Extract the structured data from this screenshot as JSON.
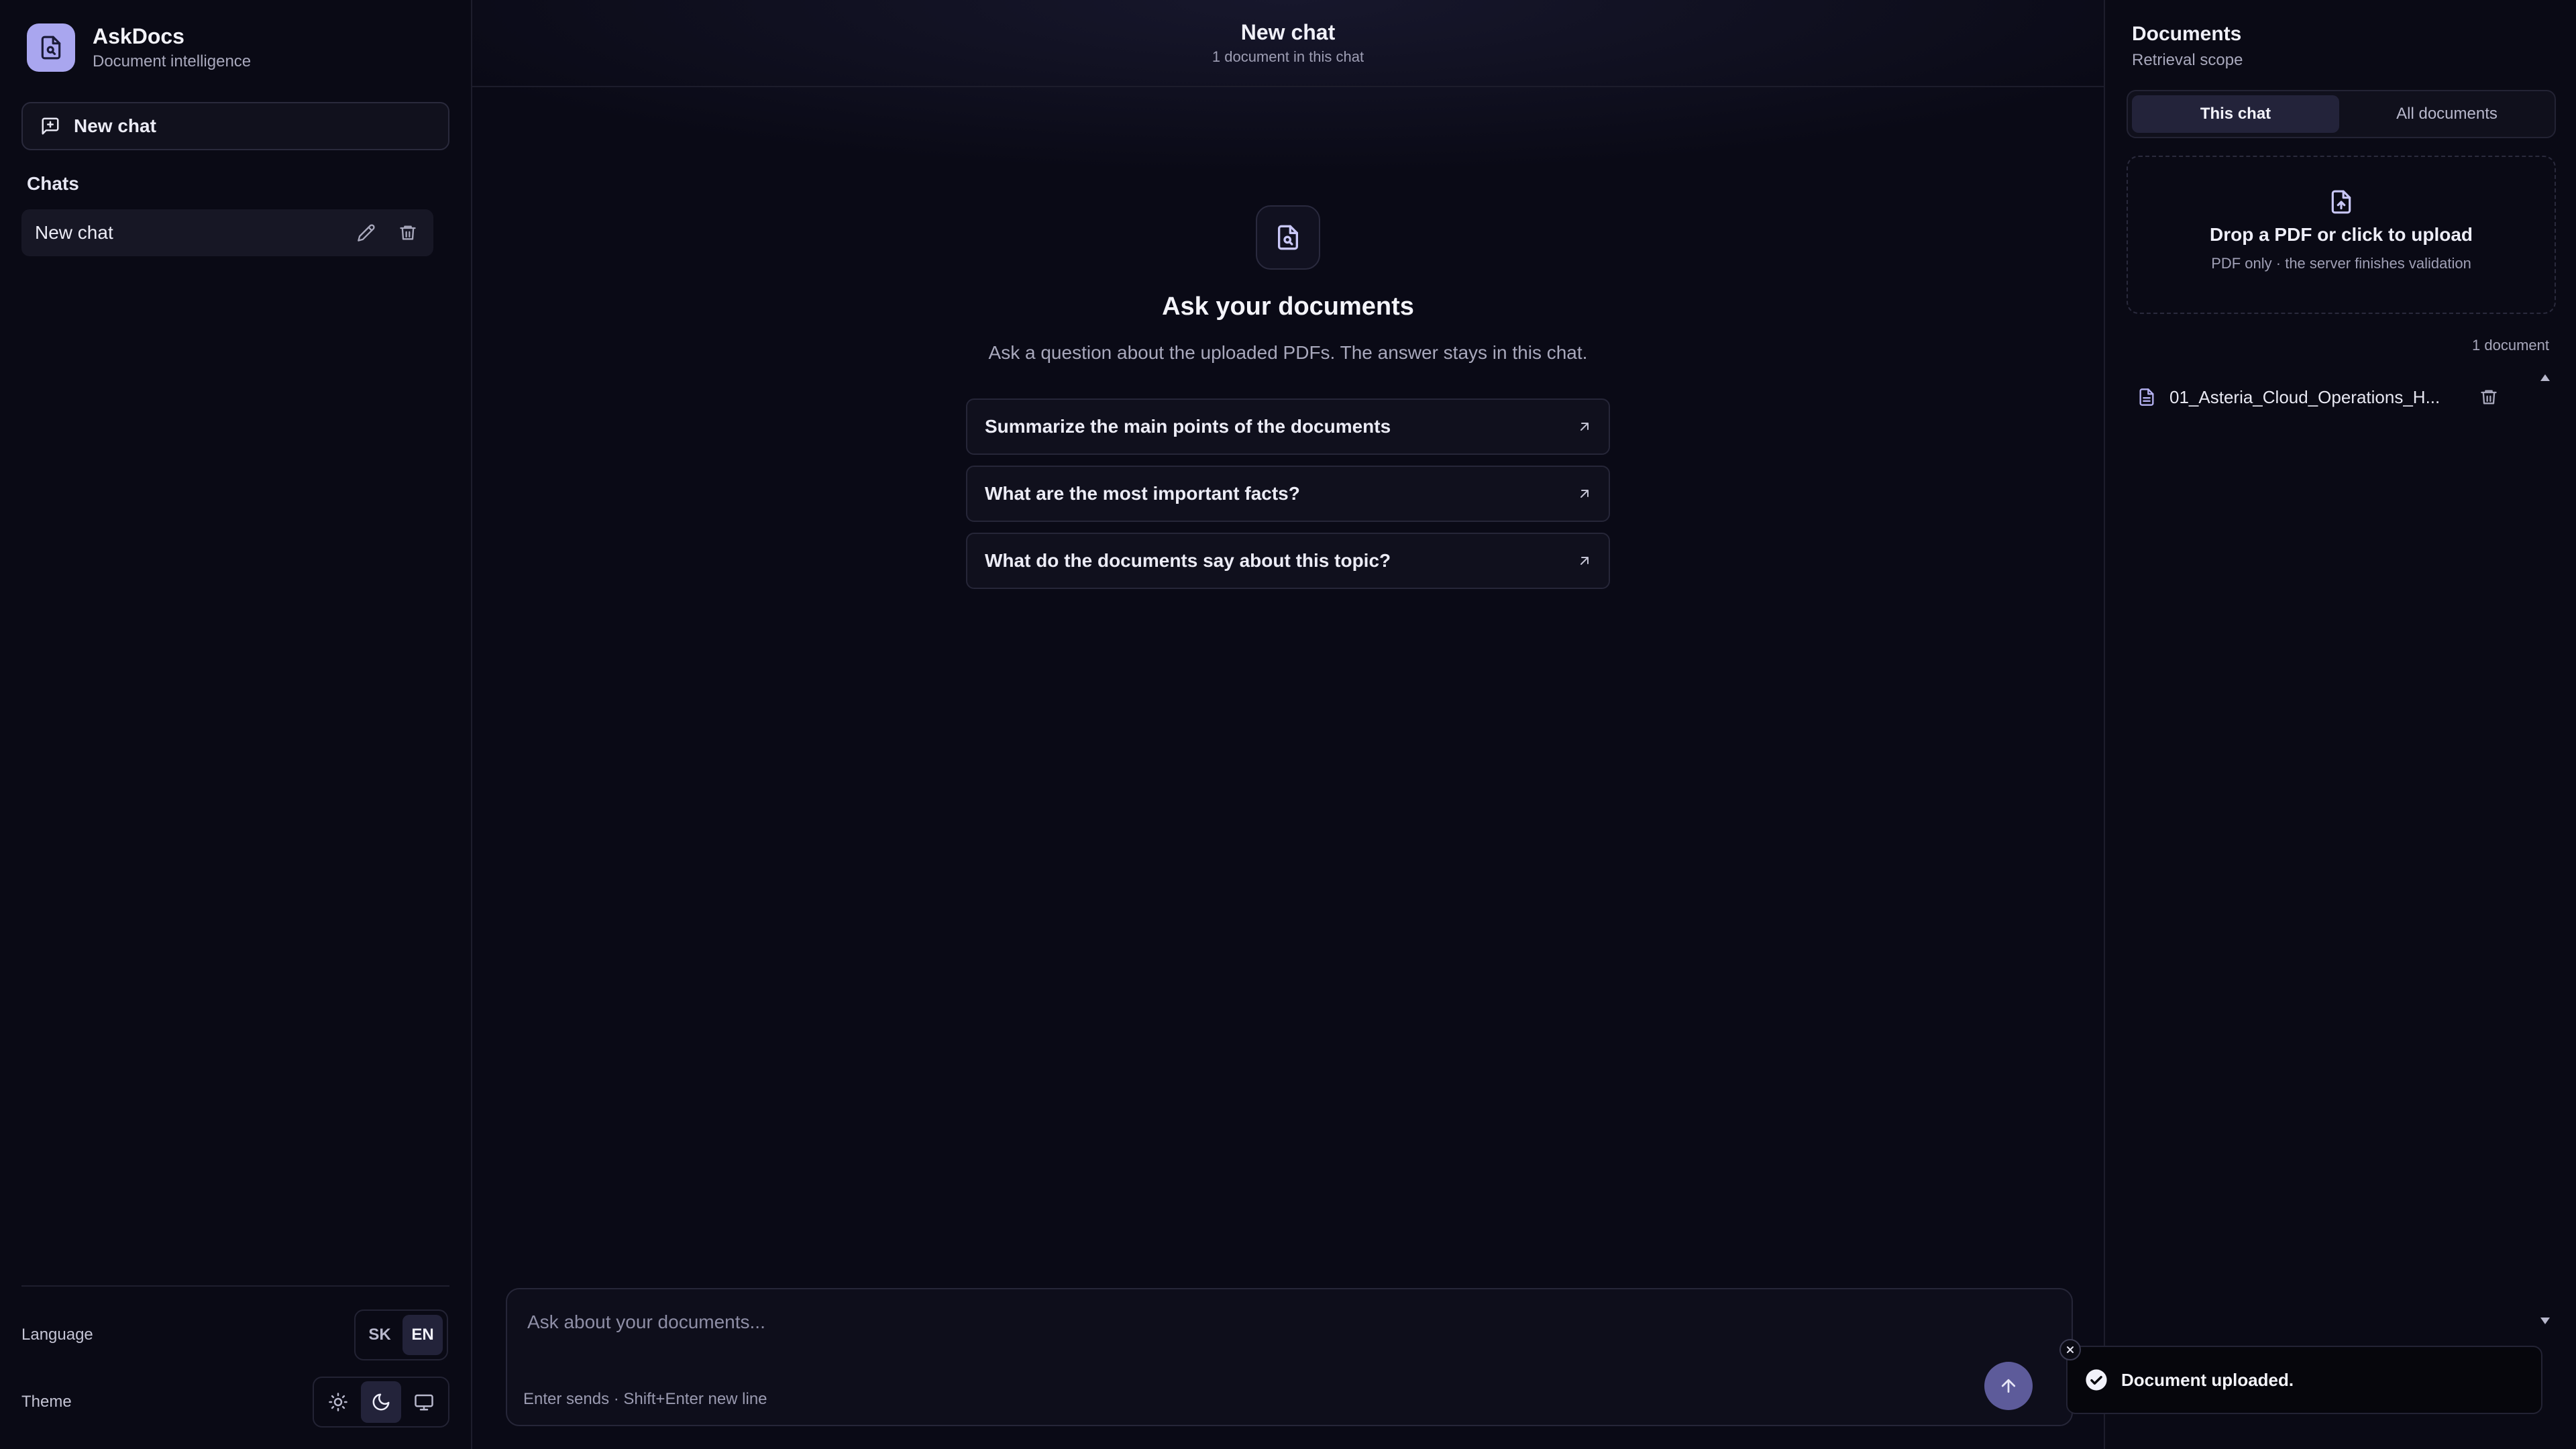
{
  "brand": {
    "name": "AskDocs",
    "subtitle": "Document intelligence"
  },
  "sidebar": {
    "new_chat_label": "New chat",
    "chats_heading": "Chats",
    "chats": [
      {
        "label": "New chat"
      }
    ],
    "language_label": "Language",
    "languages": [
      "SK",
      "EN"
    ],
    "active_language": "EN",
    "theme_label": "Theme",
    "active_theme": "dark"
  },
  "main": {
    "title": "New chat",
    "subtitle": "1 document in this chat",
    "empty_title": "Ask your documents",
    "empty_description": "Ask a question about the uploaded PDFs. The answer stays in this chat.",
    "suggestions": [
      "Summarize the main points of the documents",
      "What are the most important facts?",
      "What do the documents say about this topic?"
    ],
    "composer": {
      "placeholder": "Ask about your documents...",
      "hint": "Enter sends · Shift+Enter new line"
    }
  },
  "documents_panel": {
    "title": "Documents",
    "subtitle": "Retrieval scope",
    "tabs": [
      "This chat",
      "All documents"
    ],
    "active_tab": "This chat",
    "dropzone_title": "Drop a PDF or click to upload",
    "dropzone_subtitle": "PDF only · the server finishes validation",
    "count_label": "1 document",
    "documents": [
      {
        "name": "01_Asteria_Cloud_Operations_H..."
      }
    ]
  },
  "toast": {
    "message": "Document uploaded."
  },
  "colors": {
    "accent": "#a9a6ef",
    "send_button": "#5d5b9a",
    "background": "#0a0a16"
  }
}
